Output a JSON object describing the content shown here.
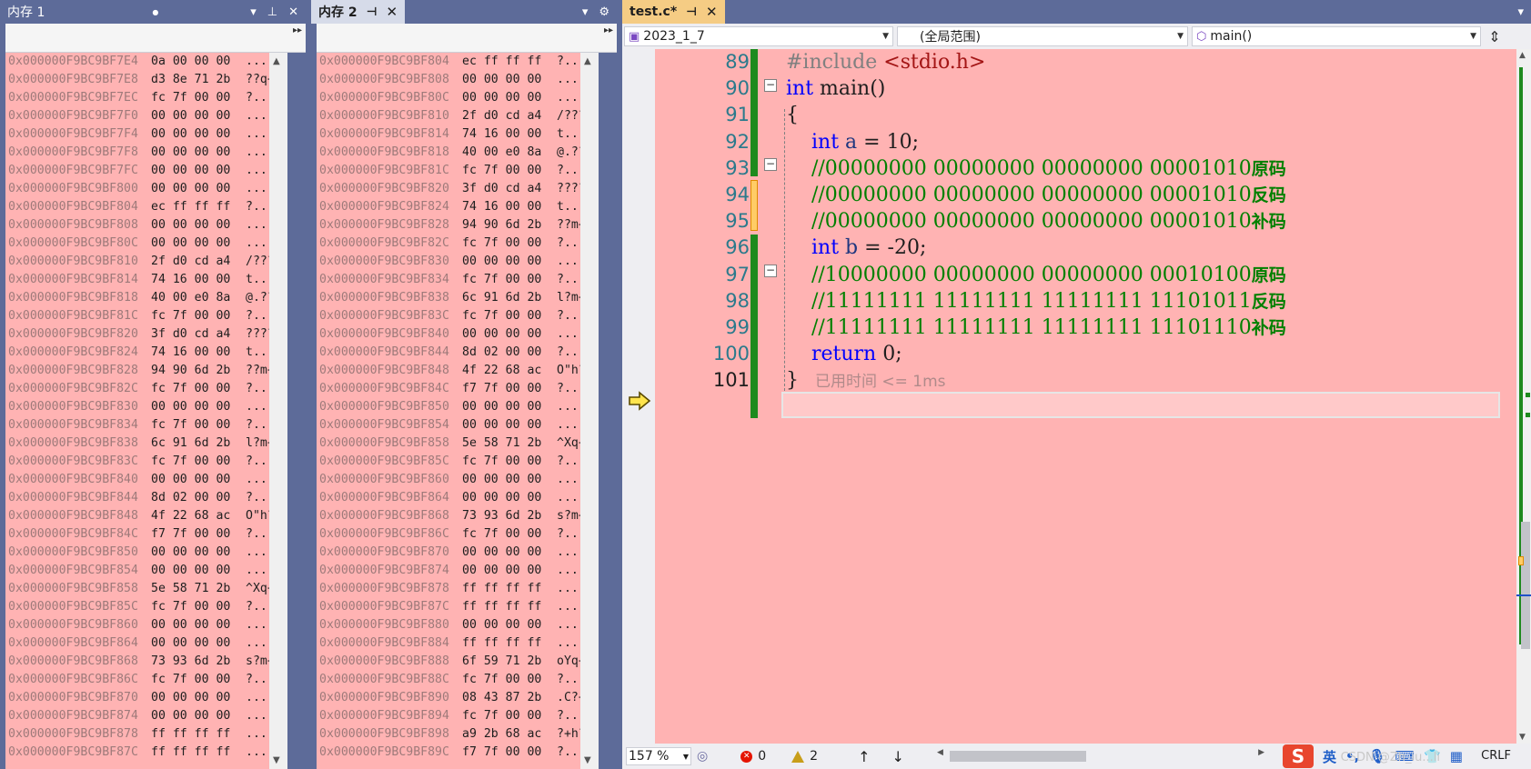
{
  "memory1": {
    "tab_label": "内存 1",
    "rows": [
      [
        "0x000000F9BC9BF7E4",
        "0a 00 00 00",
        "...."
      ],
      [
        "0x000000F9BC9BF7E8",
        "d3 8e 71 2b",
        "??q+"
      ],
      [
        "0x000000F9BC9BF7EC",
        "fc 7f 00 00",
        "?..."
      ],
      [
        "0x000000F9BC9BF7F0",
        "00 00 00 00",
        "...."
      ],
      [
        "0x000000F9BC9BF7F4",
        "00 00 00 00",
        "...."
      ],
      [
        "0x000000F9BC9BF7F8",
        "00 00 00 00",
        "...."
      ],
      [
        "0x000000F9BC9BF7FC",
        "00 00 00 00",
        "...."
      ],
      [
        "0x000000F9BC9BF800",
        "00 00 00 00",
        "...."
      ],
      [
        "0x000000F9BC9BF804",
        "ec ff ff ff",
        "?..."
      ],
      [
        "0x000000F9BC9BF808",
        "00 00 00 00",
        "...."
      ],
      [
        "0x000000F9BC9BF80C",
        "00 00 00 00",
        "...."
      ],
      [
        "0x000000F9BC9BF810",
        "2f d0 cd a4",
        "/???"
      ],
      [
        "0x000000F9BC9BF814",
        "74 16 00 00",
        "t..."
      ],
      [
        "0x000000F9BC9BF818",
        "40 00 e0 8a",
        "@.??"
      ],
      [
        "0x000000F9BC9BF81C",
        "fc 7f 00 00",
        "?..."
      ],
      [
        "0x000000F9BC9BF820",
        "3f d0 cd a4",
        "????"
      ],
      [
        "0x000000F9BC9BF824",
        "74 16 00 00",
        "t..."
      ],
      [
        "0x000000F9BC9BF828",
        "94 90 6d 2b",
        "??m+"
      ],
      [
        "0x000000F9BC9BF82C",
        "fc 7f 00 00",
        "?..."
      ],
      [
        "0x000000F9BC9BF830",
        "00 00 00 00",
        "...."
      ],
      [
        "0x000000F9BC9BF834",
        "fc 7f 00 00",
        "?..."
      ],
      [
        "0x000000F9BC9BF838",
        "6c 91 6d 2b",
        "l?m+"
      ],
      [
        "0x000000F9BC9BF83C",
        "fc 7f 00 00",
        "?..."
      ],
      [
        "0x000000F9BC9BF840",
        "00 00 00 00",
        "...."
      ],
      [
        "0x000000F9BC9BF844",
        "8d 02 00 00",
        "?..."
      ],
      [
        "0x000000F9BC9BF848",
        "4f 22 68 ac",
        "O\"h?"
      ],
      [
        "0x000000F9BC9BF84C",
        "f7 7f 00 00",
        "?..."
      ],
      [
        "0x000000F9BC9BF850",
        "00 00 00 00",
        "...."
      ],
      [
        "0x000000F9BC9BF854",
        "00 00 00 00",
        "...."
      ],
      [
        "0x000000F9BC9BF858",
        "5e 58 71 2b",
        "^Xq+"
      ],
      [
        "0x000000F9BC9BF85C",
        "fc 7f 00 00",
        "?..."
      ],
      [
        "0x000000F9BC9BF860",
        "00 00 00 00",
        "...."
      ],
      [
        "0x000000F9BC9BF864",
        "00 00 00 00",
        "...."
      ],
      [
        "0x000000F9BC9BF868",
        "73 93 6d 2b",
        "s?m+"
      ],
      [
        "0x000000F9BC9BF86C",
        "fc 7f 00 00",
        "?..."
      ],
      [
        "0x000000F9BC9BF870",
        "00 00 00 00",
        "...."
      ],
      [
        "0x000000F9BC9BF874",
        "00 00 00 00",
        "...."
      ],
      [
        "0x000000F9BC9BF878",
        "ff ff ff ff",
        "...."
      ],
      [
        "0x000000F9BC9BF87C",
        "ff ff ff ff",
        "...."
      ]
    ]
  },
  "memory2": {
    "tab_label": "内存 2",
    "rows": [
      [
        "0x000000F9BC9BF804",
        "ec ff ff ff",
        "?..."
      ],
      [
        "0x000000F9BC9BF808",
        "00 00 00 00",
        "...."
      ],
      [
        "0x000000F9BC9BF80C",
        "00 00 00 00",
        "...."
      ],
      [
        "0x000000F9BC9BF810",
        "2f d0 cd a4",
        "/???"
      ],
      [
        "0x000000F9BC9BF814",
        "74 16 00 00",
        "t..."
      ],
      [
        "0x000000F9BC9BF818",
        "40 00 e0 8a",
        "@.??"
      ],
      [
        "0x000000F9BC9BF81C",
        "fc 7f 00 00",
        "?..."
      ],
      [
        "0x000000F9BC9BF820",
        "3f d0 cd a4",
        "????"
      ],
      [
        "0x000000F9BC9BF824",
        "74 16 00 00",
        "t..."
      ],
      [
        "0x000000F9BC9BF828",
        "94 90 6d 2b",
        "??m+"
      ],
      [
        "0x000000F9BC9BF82C",
        "fc 7f 00 00",
        "?..."
      ],
      [
        "0x000000F9BC9BF830",
        "00 00 00 00",
        "...."
      ],
      [
        "0x000000F9BC9BF834",
        "fc 7f 00 00",
        "?..."
      ],
      [
        "0x000000F9BC9BF838",
        "6c 91 6d 2b",
        "l?m+"
      ],
      [
        "0x000000F9BC9BF83C",
        "fc 7f 00 00",
        "?..."
      ],
      [
        "0x000000F9BC9BF840",
        "00 00 00 00",
        "...."
      ],
      [
        "0x000000F9BC9BF844",
        "8d 02 00 00",
        "?..."
      ],
      [
        "0x000000F9BC9BF848",
        "4f 22 68 ac",
        "O\"h?"
      ],
      [
        "0x000000F9BC9BF84C",
        "f7 7f 00 00",
        "?..."
      ],
      [
        "0x000000F9BC9BF850",
        "00 00 00 00",
        "...."
      ],
      [
        "0x000000F9BC9BF854",
        "00 00 00 00",
        "...."
      ],
      [
        "0x000000F9BC9BF858",
        "5e 58 71 2b",
        "^Xq+"
      ],
      [
        "0x000000F9BC9BF85C",
        "fc 7f 00 00",
        "?..."
      ],
      [
        "0x000000F9BC9BF860",
        "00 00 00 00",
        "...."
      ],
      [
        "0x000000F9BC9BF864",
        "00 00 00 00",
        "...."
      ],
      [
        "0x000000F9BC9BF868",
        "73 93 6d 2b",
        "s?m+"
      ],
      [
        "0x000000F9BC9BF86C",
        "fc 7f 00 00",
        "?..."
      ],
      [
        "0x000000F9BC9BF870",
        "00 00 00 00",
        "...."
      ],
      [
        "0x000000F9BC9BF874",
        "00 00 00 00",
        "...."
      ],
      [
        "0x000000F9BC9BF878",
        "ff ff ff ff",
        "...."
      ],
      [
        "0x000000F9BC9BF87C",
        "ff ff ff ff",
        "...."
      ],
      [
        "0x000000F9BC9BF880",
        "00 00 00 00",
        "...."
      ],
      [
        "0x000000F9BC9BF884",
        "ff ff ff ff",
        "...."
      ],
      [
        "0x000000F9BC9BF888",
        "6f 59 71 2b",
        "oYq+"
      ],
      [
        "0x000000F9BC9BF88C",
        "fc 7f 00 00",
        "?..."
      ],
      [
        "0x000000F9BC9BF890",
        "08 43 87 2b",
        ".C?+"
      ],
      [
        "0x000000F9BC9BF894",
        "fc 7f 00 00",
        "?..."
      ],
      [
        "0x000000F9BC9BF898",
        "a9 2b 68 ac",
        "?+h?"
      ],
      [
        "0x000000F9BC9BF89C",
        "f7 7f 00 00",
        "?..."
      ]
    ]
  },
  "editor": {
    "tab_label": "test.c*",
    "project_combo": "2023_1_7",
    "scope_combo": "(全局范围)",
    "function_combo": "main()",
    "lines": [
      {
        "n": "89",
        "parts": [
          [
            "pp",
            "#include "
          ],
          [
            "inc",
            "<stdio.h>"
          ]
        ]
      },
      {
        "n": "90",
        "parts": [
          [
            "kw",
            "int"
          ],
          [
            "id",
            " main()"
          ]
        ]
      },
      {
        "n": "91",
        "parts": [
          [
            "id",
            "{"
          ]
        ]
      },
      {
        "n": "92",
        "parts": [
          [
            "id",
            "    "
          ],
          [
            "kw",
            "int"
          ],
          [
            "id",
            " "
          ],
          [
            "var",
            "a"
          ],
          [
            "id",
            " = 10;"
          ]
        ]
      },
      {
        "n": "93",
        "parts": [
          [
            "id",
            "    "
          ],
          [
            "cm",
            "//00000000 00000000 00000000 00001010"
          ],
          [
            "cmcn",
            "原码"
          ]
        ]
      },
      {
        "n": "94",
        "parts": [
          [
            "id",
            "    "
          ],
          [
            "cm",
            "//00000000 00000000 00000000 00001010"
          ],
          [
            "cmcn",
            "反码"
          ]
        ]
      },
      {
        "n": "95",
        "parts": [
          [
            "id",
            "    "
          ],
          [
            "cm",
            "//00000000 00000000 00000000 00001010"
          ],
          [
            "cmcn",
            "补码"
          ]
        ]
      },
      {
        "n": "96",
        "parts": [
          [
            "id",
            "    "
          ],
          [
            "kw",
            "int"
          ],
          [
            "id",
            " "
          ],
          [
            "var",
            "b"
          ],
          [
            "id",
            " = -20;"
          ]
        ]
      },
      {
        "n": "97",
        "parts": [
          [
            "id",
            "    "
          ],
          [
            "cm",
            "//10000000 00000000 00000000 00010100"
          ],
          [
            "cmcn",
            "原码"
          ]
        ]
      },
      {
        "n": "98",
        "parts": [
          [
            "id",
            "    "
          ],
          [
            "cm",
            "//11111111 11111111 11111111 11101011"
          ],
          [
            "cmcn",
            "反码"
          ]
        ]
      },
      {
        "n": "99",
        "parts": [
          [
            "id",
            "    "
          ],
          [
            "cm",
            "//11111111 11111111 11111111 11101110"
          ],
          [
            "cmcn",
            "补码"
          ]
        ]
      },
      {
        "n": "100",
        "parts": [
          [
            "id",
            "    "
          ],
          [
            "kw",
            "return"
          ],
          [
            "id",
            " 0;"
          ]
        ]
      },
      {
        "n": "101",
        "parts": [
          [
            "id",
            "}"
          ]
        ]
      }
    ],
    "perf_hint": "已用时间 <= 1ms"
  },
  "status": {
    "zoom": "157 %",
    "errors": "0",
    "warnings": "2",
    "line_ending": "CRLF",
    "ime_label": "英",
    "ime_logo": "S",
    "watermark": "CSDN @Zh_iu...li"
  },
  "colors": {
    "memory_background": "#ffb3b3",
    "editor_background": "#ffb3b3",
    "active_doc_tab": "#f5cc84",
    "window_chrome": "#5d6b99",
    "change_bar_saved": "#1e8a1e",
    "change_bar_unsaved": "#ffcc66"
  }
}
